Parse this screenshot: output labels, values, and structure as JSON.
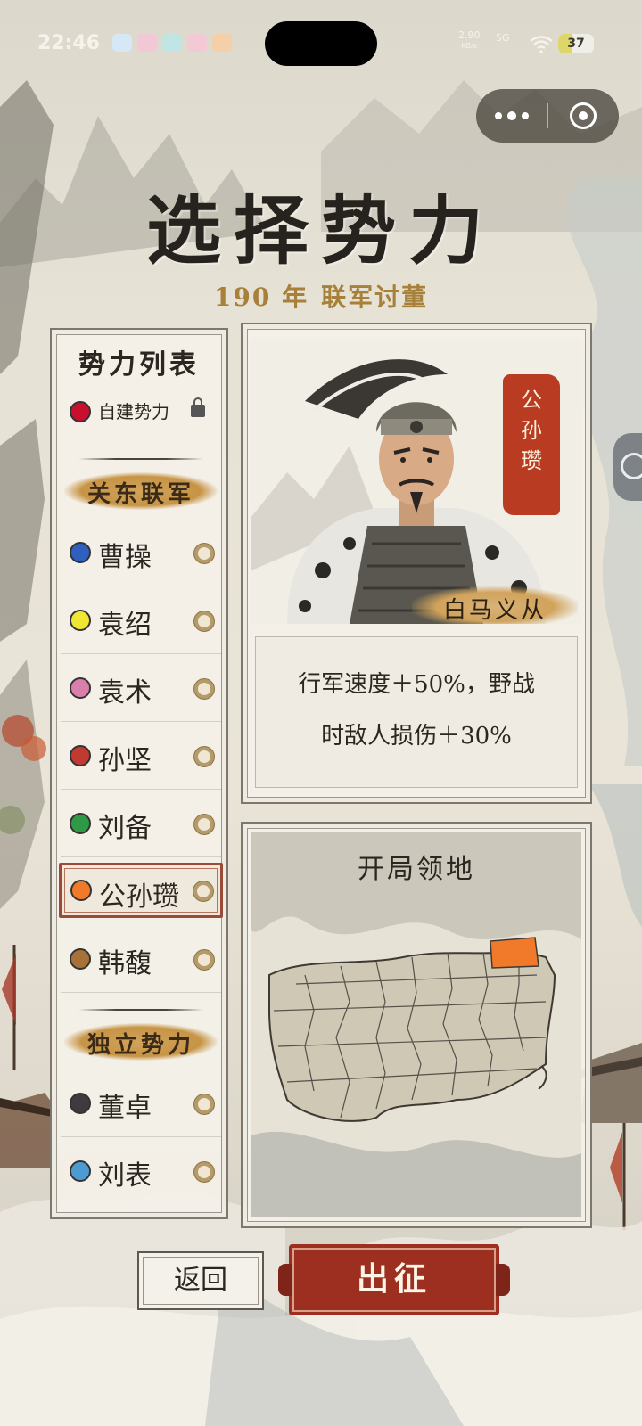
{
  "status_bar": {
    "time": "22:46",
    "network_speed": "2.90",
    "network_unit": "KB/s",
    "signal": "5G",
    "battery": "37"
  },
  "header": {
    "title": "选择势力",
    "year": "190 年",
    "scenario": "联军讨董"
  },
  "faction_list": {
    "heading": "势力列表",
    "custom": {
      "label": "自建势力",
      "color": "#c8102e"
    },
    "groups": [
      {
        "label": "关东联军",
        "items": [
          {
            "name": "曹操",
            "color": "#2f5fbf"
          },
          {
            "name": "袁绍",
            "color": "#f2e635"
          },
          {
            "name": "袁术",
            "color": "#d97fa9"
          },
          {
            "name": "孙坚",
            "color": "#c03a31"
          },
          {
            "name": "刘备",
            "color": "#2f9a46"
          },
          {
            "name": "公孙瓒",
            "color": "#f07a2a",
            "selected": true
          },
          {
            "name": "韩馥",
            "color": "#a87138"
          }
        ]
      },
      {
        "label": "独立势力",
        "items": [
          {
            "name": "董卓",
            "color": "#3e3b3e"
          },
          {
            "name": "刘表",
            "color": "#4e9bd2"
          }
        ]
      }
    ]
  },
  "hero": {
    "name_seal": "公孙瓒",
    "unit_name": "白马义从",
    "description_line1": "行军速度＋50%，野战",
    "description_line2": "时敌人损伤＋30%"
  },
  "territory": {
    "title": "开局领地",
    "highlight_color": "#f07a2a"
  },
  "actions": {
    "back": "返回",
    "go": "出征"
  }
}
